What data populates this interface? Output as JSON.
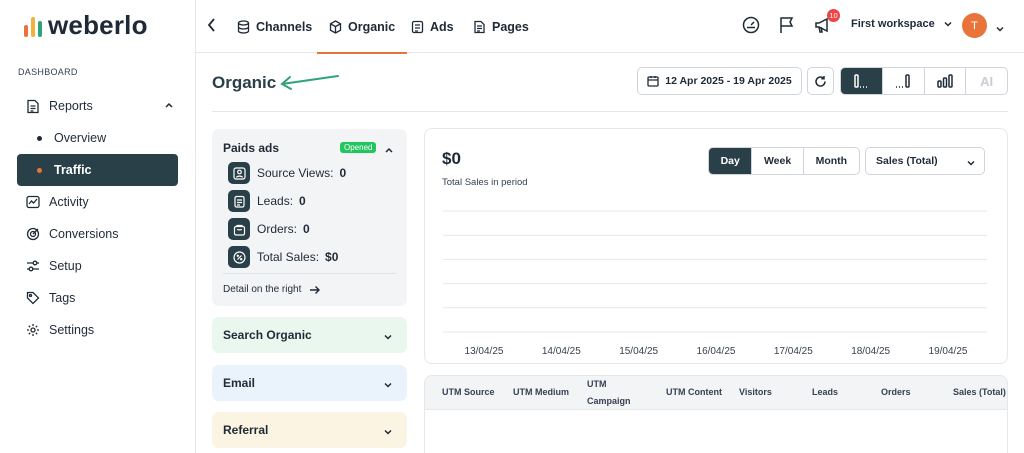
{
  "brand": {
    "name": "weberlo",
    "bar_colors": [
      "#e8743b",
      "#f2b33d",
      "#2fa37a"
    ]
  },
  "sidebar": {
    "section_label": "DASHBOARD",
    "items": [
      {
        "label": "Reports",
        "icon": "document-icon"
      },
      {
        "label": "Activity",
        "icon": "activity-icon"
      },
      {
        "label": "Conversions",
        "icon": "target-icon"
      },
      {
        "label": "Setup",
        "icon": "sliders-icon"
      },
      {
        "label": "Tags",
        "icon": "tag-icon"
      },
      {
        "label": "Settings",
        "icon": "gear-icon"
      }
    ],
    "sub_items": [
      {
        "label": "Overview",
        "active": false
      },
      {
        "label": "Traffic",
        "active": true
      }
    ]
  },
  "topbar": {
    "tabs": [
      {
        "label": "Channels",
        "icon": "database-icon"
      },
      {
        "label": "Organic",
        "icon": "cube-icon",
        "active": true
      },
      {
        "label": "Ads",
        "icon": "ad-icon"
      },
      {
        "label": "Pages",
        "icon": "pages-icon"
      }
    ],
    "notification_count": "10",
    "workspace": "First workspace",
    "avatar_initial": "T"
  },
  "header": {
    "title": "Organic",
    "date_range": "12 Apr 2025 - 19 Apr 2025",
    "ai_label": "AI"
  },
  "paid_ads": {
    "title": "Paids ads",
    "status": "Opened",
    "metrics": [
      {
        "label": "Source Views:",
        "value": "0",
        "icon": "user-card-icon"
      },
      {
        "label": "Leads:",
        "value": "0",
        "icon": "clipboard-icon"
      },
      {
        "label": "Orders:",
        "value": "0",
        "icon": "bag-icon"
      },
      {
        "label": "Total Sales:",
        "value": "$0",
        "icon": "percent-icon"
      }
    ],
    "detail_link": "Detail on the right"
  },
  "sections": {
    "search_organic": "Search Organic",
    "email": "Email",
    "referral": "Referral"
  },
  "chart": {
    "amount": "$0",
    "subtitle": "Total Sales in period",
    "periods": [
      "Day",
      "Week",
      "Month"
    ],
    "active_period": "Day",
    "metric_select": "Sales (Total)"
  },
  "chart_data": {
    "type": "line",
    "title": "",
    "xlabel": "",
    "ylabel": "",
    "categories": [
      "13/04/25",
      "14/04/25",
      "15/04/25",
      "16/04/25",
      "17/04/25",
      "18/04/25",
      "19/04/25"
    ],
    "series": [
      {
        "values": [
          0,
          0,
          0,
          0,
          0,
          0,
          0
        ]
      }
    ],
    "grid": true
  },
  "table": {
    "columns": [
      "UTM Source",
      "UTM Medium",
      "UTM Campaign",
      "UTM Content",
      "Visitors",
      "Leads",
      "Orders",
      "Sales (Total)"
    ]
  },
  "colors": {
    "accent": "#e8743b",
    "primary_dark": "#2a4049",
    "success": "#22c55e"
  }
}
